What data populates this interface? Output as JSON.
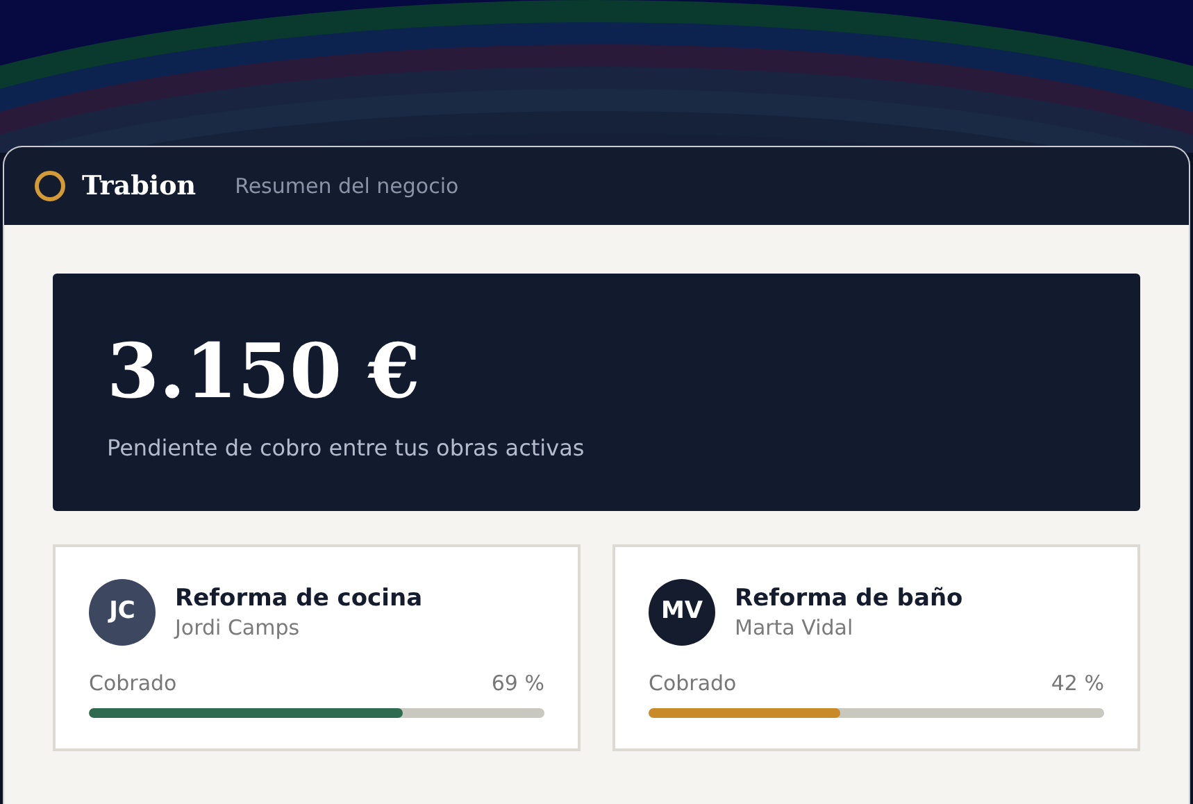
{
  "app": {
    "name": "Trabion",
    "subtitle": "Resumen del negocio"
  },
  "summary": {
    "amount": "3.150 €",
    "caption": "Pendiente de cobro entre tus obras activas"
  },
  "projects": [
    {
      "avatar": {
        "initials": "JC",
        "color": "#3d4760"
      },
      "title": "Reforma de cocina",
      "client": "Jordi Camps",
      "label": "Cobrado",
      "percent": "69 %",
      "level": 0.69,
      "color": "#2f6b4f"
    },
    {
      "avatar": {
        "initials": "MV",
        "color": "#141c2e"
      },
      "title": "Reforma de baño",
      "client": "Marta Vidal",
      "label": "Cobrado",
      "percent": "42 %",
      "level": 0.42,
      "color": "#c98a2a"
    }
  ]
}
